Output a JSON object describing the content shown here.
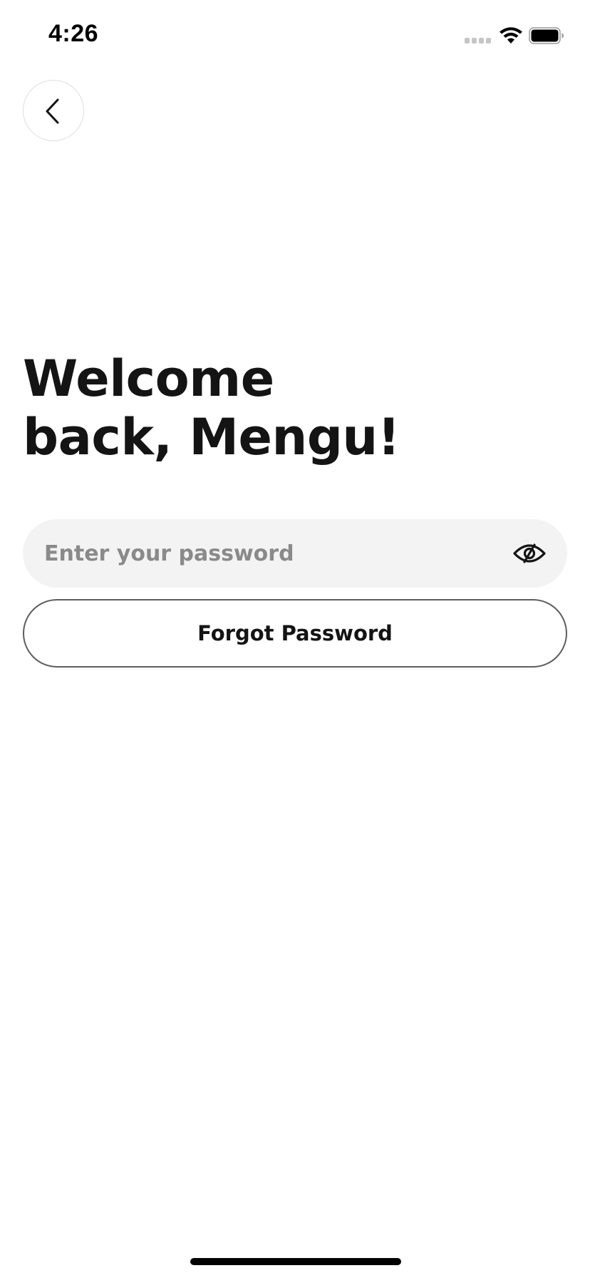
{
  "status_bar": {
    "time": "4:26",
    "icons": [
      "cellular-signal-icon",
      "wifi-icon",
      "battery-icon"
    ]
  },
  "navigation": {
    "back_icon": "chevron-left-icon"
  },
  "title": {
    "line1": "Welcome",
    "line2": "back, Mengu!"
  },
  "password": {
    "placeholder": "Enter your password",
    "value": "",
    "toggle_icon": "eye-slash-icon"
  },
  "forgot_password": {
    "label": "Forgot Password"
  },
  "colors": {
    "text": "#141414",
    "field_background": "#f3f3f3",
    "placeholder": "#8a8a8a",
    "button_border": "#5e5e5e",
    "back_border": "#dedede"
  }
}
